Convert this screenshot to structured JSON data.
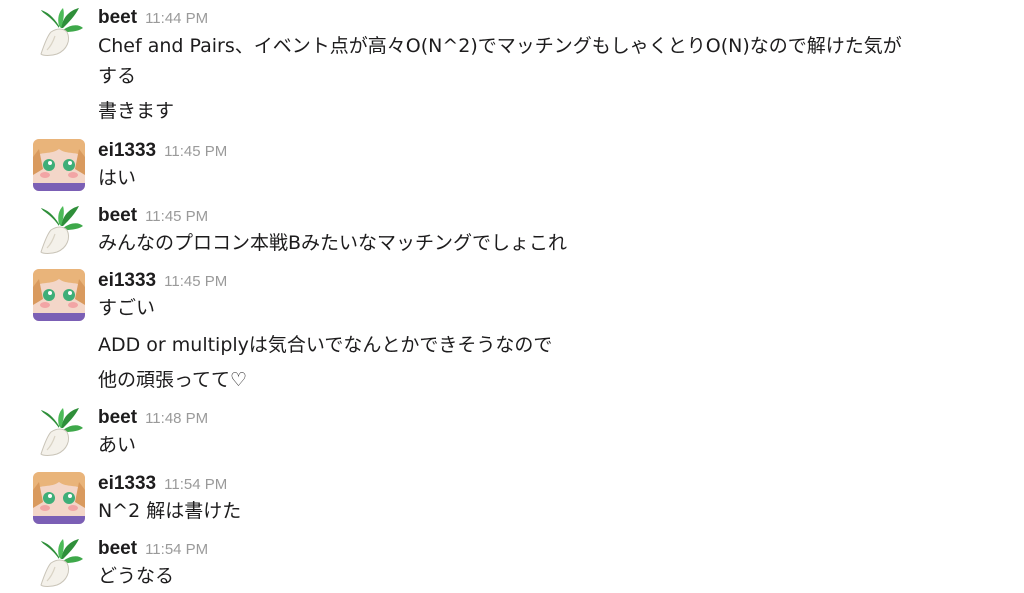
{
  "messages": [
    {
      "author": "beet",
      "time": "11:44 PM",
      "avatar_icon": "beet-vegetable-icon",
      "lines": [
        "Chef and Pairs、イベント点が高々O(N^2)でマッチングもしゃくとりO(N)なので解けた気が",
        "する",
        "書きます"
      ]
    },
    {
      "author": "ei1333",
      "time": "11:45 PM",
      "avatar_icon": "anime-girl-avatar-icon",
      "lines": [
        "はい"
      ]
    },
    {
      "author": "beet",
      "time": "11:45 PM",
      "avatar_icon": "beet-vegetable-icon",
      "lines": [
        "みんなのプロコン本戦Bみたいなマッチングでしょこれ"
      ]
    },
    {
      "author": "ei1333",
      "time": "11:45 PM",
      "avatar_icon": "anime-girl-avatar-icon",
      "lines": [
        "すごい",
        "ADD or multiplyは気合いでなんとかできそうなので",
        "他の頑張ってて♡"
      ]
    },
    {
      "author": "beet",
      "time": "11:48 PM",
      "avatar_icon": "beet-vegetable-icon",
      "lines": [
        "あい"
      ]
    },
    {
      "author": "ei1333",
      "time": "11:54 PM",
      "avatar_icon": "anime-girl-avatar-icon",
      "lines": [
        "N^2 解は書けた"
      ]
    },
    {
      "author": "beet",
      "time": "11:54 PM",
      "avatar_icon": "beet-vegetable-icon",
      "lines": [
        "どうなる"
      ]
    }
  ],
  "colors": {
    "text": "#1d1c1d",
    "timestamp": "#9a9a9a",
    "beet_leaf": "#2f8f3a",
    "anime_hair": "#e9b47a",
    "anime_eye": "#3fae78"
  }
}
